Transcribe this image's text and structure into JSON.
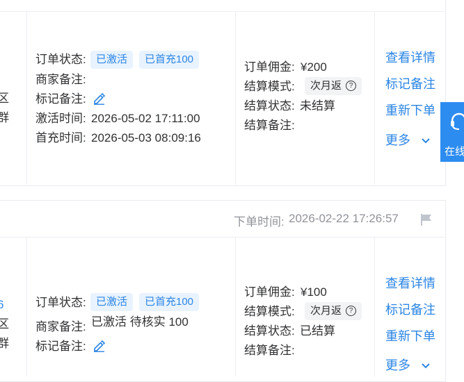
{
  "orders": [
    {
      "left_fragments": {
        "line1": "区",
        "line2": "群"
      },
      "status": {
        "label": "订单状态:",
        "tags": [
          "已激活",
          "已首充100"
        ]
      },
      "merchant_note": {
        "label": "商家备注:",
        "value": ""
      },
      "mark_note": {
        "label": "标记备注:"
      },
      "activation": {
        "label": "激活时间:",
        "value": "2026-05-02 17:11:00"
      },
      "first_recharge": {
        "label": "首充时间:",
        "value": "2026-05-03 08:09:16"
      },
      "commission": {
        "label": "订单佣金:",
        "value": "¥200"
      },
      "settle_mode": {
        "label": "结算模式:",
        "value": "次月返"
      },
      "settle_status": {
        "label": "结算状态:",
        "value": "未结算"
      },
      "settle_note": {
        "label": "结算备注:",
        "value": ""
      },
      "actions": {
        "details": "查看详情",
        "mark": "标记备注",
        "reorder": "重新下单",
        "more": "更多"
      }
    },
    {
      "header": {
        "order_time_label": "下单时间:",
        "order_time": "2026-02-22 17:26:57"
      },
      "left_fragments": {
        "line0": "6",
        "line1": "区",
        "line2": "群"
      },
      "status": {
        "label": "订单状态:",
        "tags": [
          "已激活",
          "已首充100"
        ]
      },
      "merchant_note": {
        "label": "商家备注:",
        "value": "已激活 待核实 100"
      },
      "mark_note": {
        "label": "标记备注:"
      },
      "commission": {
        "label": "订单佣金:",
        "value": "¥100"
      },
      "settle_mode": {
        "label": "结算模式:",
        "value": "次月返"
      },
      "settle_status": {
        "label": "结算状态:",
        "value": "已结算"
      },
      "settle_note": {
        "label": "结算备注:",
        "value": ""
      },
      "actions": {
        "details": "查看详情",
        "mark": "标记备注",
        "reorder": "重新下单",
        "more": "更多"
      }
    }
  ],
  "floating": {
    "label": "在线"
  },
  "colors": {
    "link": "#2b85e4",
    "tag_bg": "#e8f3ff",
    "fab": "#2d8cf0"
  },
  "icons": [
    "edit-icon",
    "question-icon",
    "chevron-down-icon",
    "flag-icon",
    "headset-icon"
  ]
}
